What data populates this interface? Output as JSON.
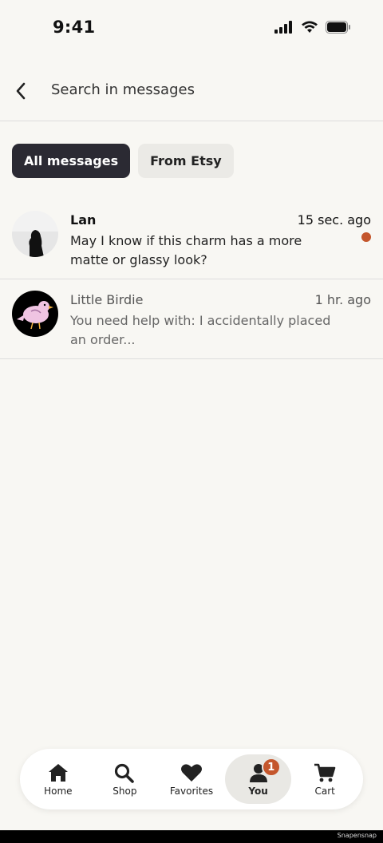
{
  "status_bar": {
    "time": "9:41"
  },
  "header": {
    "search_label": "Search in messages"
  },
  "filters": [
    {
      "label": "All messages",
      "active": true
    },
    {
      "label": "From Etsy",
      "active": false
    }
  ],
  "messages": [
    {
      "name": "Lan",
      "time": "15 sec. ago",
      "preview": "May I know if this charm has a more matte or glassy look?",
      "unread": true
    },
    {
      "name": "Little Birdie",
      "time": "1 hr. ago",
      "preview": "You need help with: I accidentally placed an order...",
      "unread": false
    }
  ],
  "nav": {
    "items": [
      {
        "label": "Home",
        "icon": "home-icon"
      },
      {
        "label": "Shop",
        "icon": "search-icon"
      },
      {
        "label": "Favorites",
        "icon": "heart-icon"
      },
      {
        "label": "You",
        "icon": "person-icon",
        "active": true,
        "badge": "1"
      },
      {
        "label": "Cart",
        "icon": "cart-icon"
      }
    ]
  },
  "watermark": "Snapensnap",
  "colors": {
    "accent": "#c4562c",
    "chip_active": "#2b2a33",
    "background": "#f8f7f3"
  }
}
